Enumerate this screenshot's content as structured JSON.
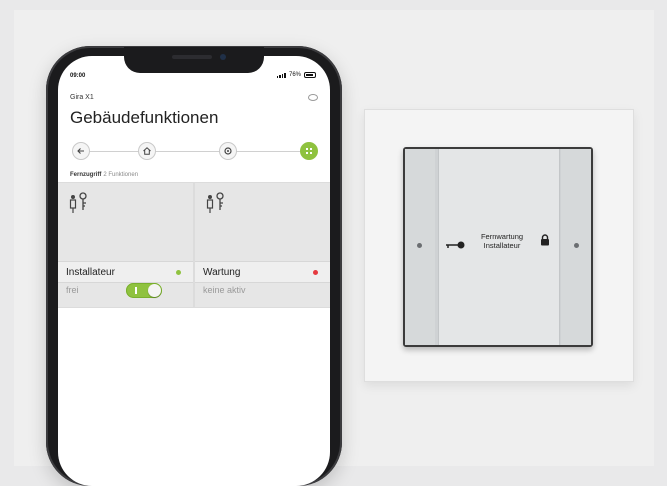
{
  "status_bar": {
    "time": "09:00",
    "signal": "76%"
  },
  "app": {
    "name": "Gira X1",
    "title": "Gebäudefunktionen"
  },
  "section": {
    "title": "Fernzugriff",
    "subtitle": "2 Funktionen"
  },
  "tiles": [
    {
      "label": "Installateur",
      "state": "frei",
      "dot_color": "#8fc23f",
      "toggle_on": true
    },
    {
      "label": "Wartung",
      "state": "keine aktiv",
      "dot_color": "#e5393f"
    }
  ],
  "device": {
    "line1": "Fernwartung",
    "line2": "Installateur"
  },
  "colors": {
    "accent": "#8fc23f",
    "alert": "#e5393f"
  }
}
